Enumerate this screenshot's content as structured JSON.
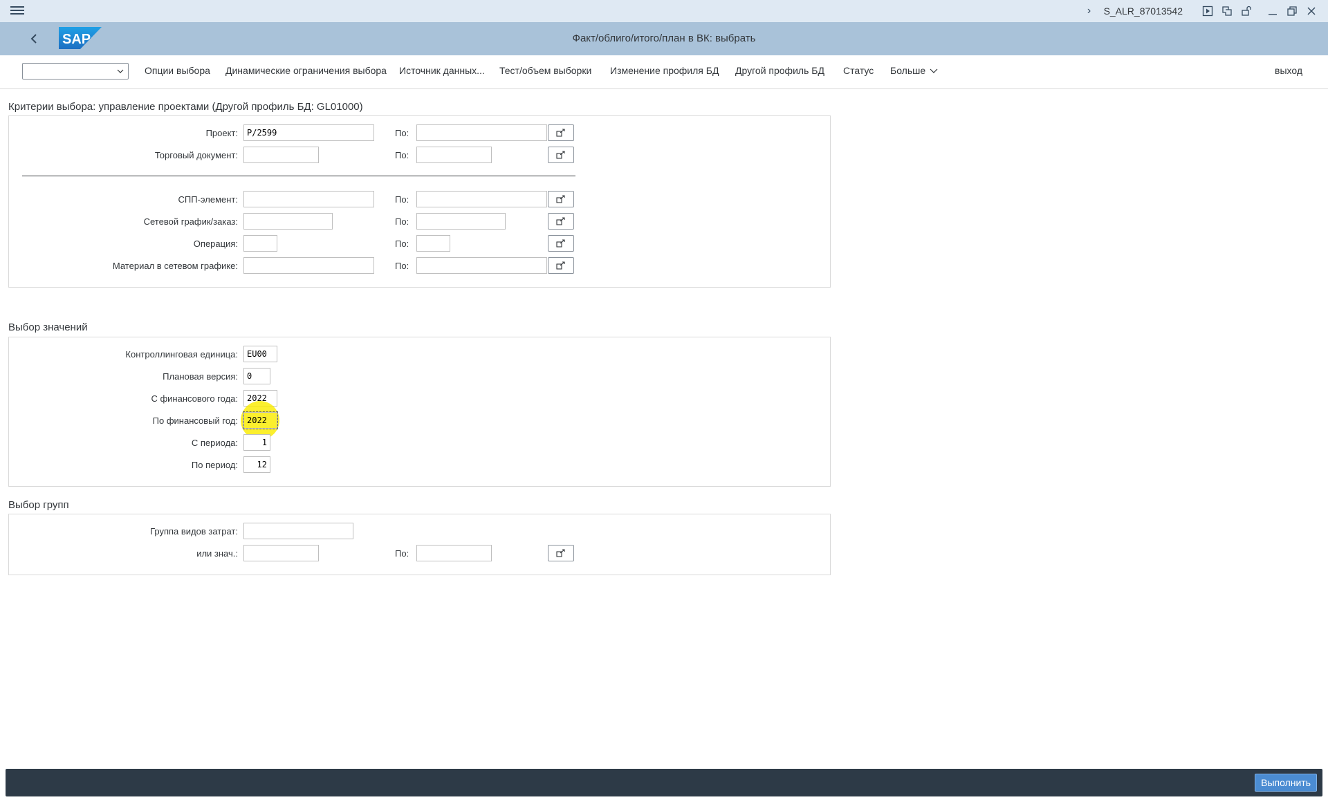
{
  "titlebar": {
    "transaction_code": "S_ALR_87013542"
  },
  "shell": {
    "logo_text": "SAP",
    "title": "Факт/облиго/итого/план в ВК: выбрать"
  },
  "toolbar": {
    "variant_value": "",
    "items": [
      "Опции выбора",
      "Динамические ограничения выбора",
      "Источник данных...",
      "Тест/объем выборки",
      "Изменение профиля БД",
      "Другой профиль БД",
      "Статус",
      "Больше"
    ],
    "exit_label": "выход"
  },
  "criteria": {
    "title": "Критерии выбора: управление проектами (Другой профиль БД: GL01000)",
    "to_label": "По:",
    "rows": [
      {
        "label": "Проект:",
        "from": "P/2599",
        "to": ""
      },
      {
        "label": "Торговый документ:",
        "from": "",
        "to": ""
      },
      {
        "label": "СПП-элемент:",
        "from": "",
        "to": ""
      },
      {
        "label": "Сетевой график/заказ:",
        "from": "",
        "to": ""
      },
      {
        "label": "Операция:",
        "from": "",
        "to": ""
      },
      {
        "label": "Материал в сетевом графике:",
        "from": "",
        "to": ""
      }
    ]
  },
  "values": {
    "title": "Выбор значений",
    "rows": [
      {
        "label": "Контроллинговая единица:",
        "value": "EU00"
      },
      {
        "label": "Плановая версия:",
        "value": "0"
      },
      {
        "label": "С финансового года:",
        "value": "2022"
      },
      {
        "label": "По финансовый год:",
        "value": "2022"
      },
      {
        "label": "С периода:",
        "value": "1"
      },
      {
        "label": "По период:",
        "value": "12"
      }
    ]
  },
  "groups": {
    "title": "Выбор групп",
    "to_label": "По:",
    "rows": [
      {
        "label": "Группа видов затрат:",
        "value": ""
      },
      {
        "label": "или знач.:",
        "from": "",
        "to": ""
      }
    ]
  },
  "footer": {
    "execute_label": "Выполнить"
  },
  "colors": {
    "titlebar_bg": "#dfe9f3",
    "shell_bg": "#a9c2d9",
    "footer_bg": "#2d3a47",
    "execute_bg": "#4b8cd2",
    "sap_logo": "#1f8dd6",
    "cursor_highlight": "#faeb00"
  }
}
